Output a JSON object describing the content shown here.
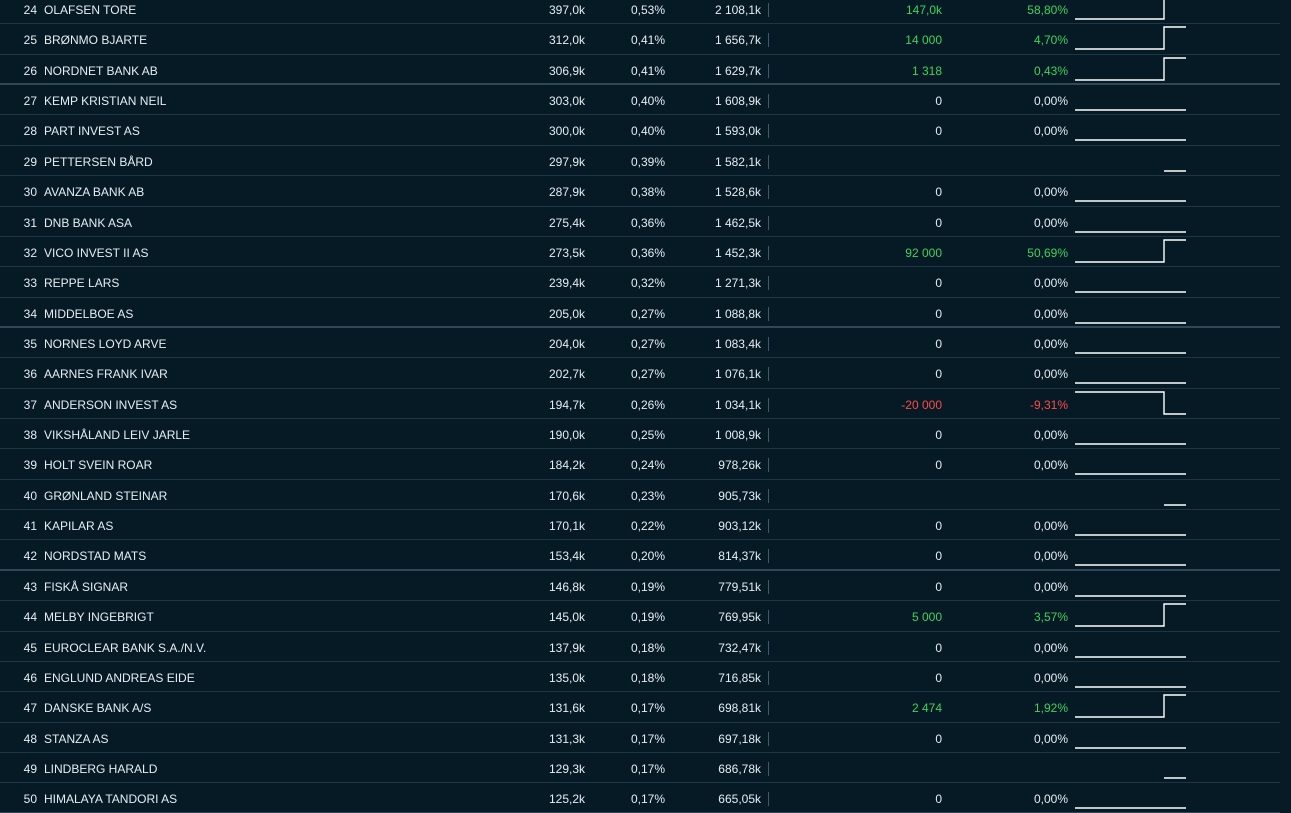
{
  "colors": {
    "background": "#061a26",
    "text": "#e6edf2",
    "positive": "#3fd35a",
    "negative": "#ff4a4a",
    "row_divider": "#1e3644"
  },
  "rows": [
    {
      "rank": "24",
      "name": "OLAFSEN TORE",
      "shares": "397,0k",
      "pct": "0,53%",
      "value": "2 108,1k",
      "change": "147,0k",
      "change_pct": "58,80%",
      "trend": "up"
    },
    {
      "rank": "25",
      "name": "BRØNMO BJARTE",
      "shares": "312,0k",
      "pct": "0,41%",
      "value": "1 656,7k",
      "change": "14 000",
      "change_pct": "4,70%",
      "trend": "up"
    },
    {
      "rank": "26",
      "name": "NORDNET BANK AB",
      "shares": "306,9k",
      "pct": "0,41%",
      "value": "1 629,7k",
      "change": "1 318",
      "change_pct": "0,43%",
      "trend": "up"
    },
    {
      "rank": "27",
      "name": "KEMP KRISTIAN NEIL",
      "shares": "303,0k",
      "pct": "0,40%",
      "value": "1 608,9k",
      "change": "0",
      "change_pct": "0,00%",
      "trend": "flat"
    },
    {
      "rank": "28",
      "name": "PART INVEST AS",
      "shares": "300,0k",
      "pct": "0,40%",
      "value": "1 593,0k",
      "change": "0",
      "change_pct": "0,00%",
      "trend": "flat"
    },
    {
      "rank": "29",
      "name": "PETTERSEN BÅRD",
      "shares": "297,9k",
      "pct": "0,39%",
      "value": "1 582,1k",
      "change": "",
      "change_pct": "",
      "trend": "new"
    },
    {
      "rank": "30",
      "name": "AVANZA BANK AB",
      "shares": "287,9k",
      "pct": "0,38%",
      "value": "1 528,6k",
      "change": "0",
      "change_pct": "0,00%",
      "trend": "flat"
    },
    {
      "rank": "31",
      "name": "DNB BANK ASA",
      "shares": "275,4k",
      "pct": "0,36%",
      "value": "1 462,5k",
      "change": "0",
      "change_pct": "0,00%",
      "trend": "flat"
    },
    {
      "rank": "32",
      "name": "VICO INVEST II AS",
      "shares": "273,5k",
      "pct": "0,36%",
      "value": "1 452,3k",
      "change": "92 000",
      "change_pct": "50,69%",
      "trend": "up"
    },
    {
      "rank": "33",
      "name": "REPPE LARS",
      "shares": "239,4k",
      "pct": "0,32%",
      "value": "1 271,3k",
      "change": "0",
      "change_pct": "0,00%",
      "trend": "flat"
    },
    {
      "rank": "34",
      "name": "MIDDELBOE AS",
      "shares": "205,0k",
      "pct": "0,27%",
      "value": "1 088,8k",
      "change": "0",
      "change_pct": "0,00%",
      "trend": "flat"
    },
    {
      "rank": "35",
      "name": "NORNES LOYD ARVE",
      "shares": "204,0k",
      "pct": "0,27%",
      "value": "1 083,4k",
      "change": "0",
      "change_pct": "0,00%",
      "trend": "flat"
    },
    {
      "rank": "36",
      "name": "AARNES FRANK IVAR",
      "shares": "202,7k",
      "pct": "0,27%",
      "value": "1 076,1k",
      "change": "0",
      "change_pct": "0,00%",
      "trend": "flat"
    },
    {
      "rank": "37",
      "name": "ANDERSON INVEST AS",
      "shares": "194,7k",
      "pct": "0,26%",
      "value": "1 034,1k",
      "change": "-20 000",
      "change_pct": "-9,31%",
      "trend": "down"
    },
    {
      "rank": "38",
      "name": "VIKSHÅLAND LEIV JARLE",
      "shares": "190,0k",
      "pct": "0,25%",
      "value": "1 008,9k",
      "change": "0",
      "change_pct": "0,00%",
      "trend": "flat"
    },
    {
      "rank": "39",
      "name": "HOLT SVEIN ROAR",
      "shares": "184,2k",
      "pct": "0,24%",
      "value": "978,26k",
      "change": "0",
      "change_pct": "0,00%",
      "trend": "flat"
    },
    {
      "rank": "40",
      "name": "GRØNLAND STEINAR",
      "shares": "170,6k",
      "pct": "0,23%",
      "value": "905,73k",
      "change": "",
      "change_pct": "",
      "trend": "new"
    },
    {
      "rank": "41",
      "name": "KAPILAR AS",
      "shares": "170,1k",
      "pct": "0,22%",
      "value": "903,12k",
      "change": "0",
      "change_pct": "0,00%",
      "trend": "flat"
    },
    {
      "rank": "42",
      "name": "NORDSTAD MATS",
      "shares": "153,4k",
      "pct": "0,20%",
      "value": "814,37k",
      "change": "0",
      "change_pct": "0,00%",
      "trend": "flat"
    },
    {
      "rank": "43",
      "name": "FISKÅ SIGNAR",
      "shares": "146,8k",
      "pct": "0,19%",
      "value": "779,51k",
      "change": "0",
      "change_pct": "0,00%",
      "trend": "flat"
    },
    {
      "rank": "44",
      "name": "MELBY INGEBRIGT",
      "shares": "145,0k",
      "pct": "0,19%",
      "value": "769,95k",
      "change": "5 000",
      "change_pct": "3,57%",
      "trend": "up"
    },
    {
      "rank": "45",
      "name": "EUROCLEAR BANK S.A./N.V.",
      "shares": "137,9k",
      "pct": "0,18%",
      "value": "732,47k",
      "change": "0",
      "change_pct": "0,00%",
      "trend": "flat"
    },
    {
      "rank": "46",
      "name": "ENGLUND ANDREAS EIDE",
      "shares": "135,0k",
      "pct": "0,18%",
      "value": "716,85k",
      "change": "0",
      "change_pct": "0,00%",
      "trend": "flat"
    },
    {
      "rank": "47",
      "name": "DANSKE BANK A/S",
      "shares": "131,6k",
      "pct": "0,17%",
      "value": "698,81k",
      "change": "2 474",
      "change_pct": "1,92%",
      "trend": "up"
    },
    {
      "rank": "48",
      "name": "STANZA AS",
      "shares": "131,3k",
      "pct": "0,17%",
      "value": "697,18k",
      "change": "0",
      "change_pct": "0,00%",
      "trend": "flat"
    },
    {
      "rank": "49",
      "name": "LINDBERG HARALD",
      "shares": "129,3k",
      "pct": "0,17%",
      "value": "686,78k",
      "change": "",
      "change_pct": "",
      "trend": "new"
    },
    {
      "rank": "50",
      "name": "HIMALAYA TANDORI AS",
      "shares": "125,2k",
      "pct": "0,17%",
      "value": "665,05k",
      "change": "0",
      "change_pct": "0,00%",
      "trend": "flat"
    }
  ]
}
